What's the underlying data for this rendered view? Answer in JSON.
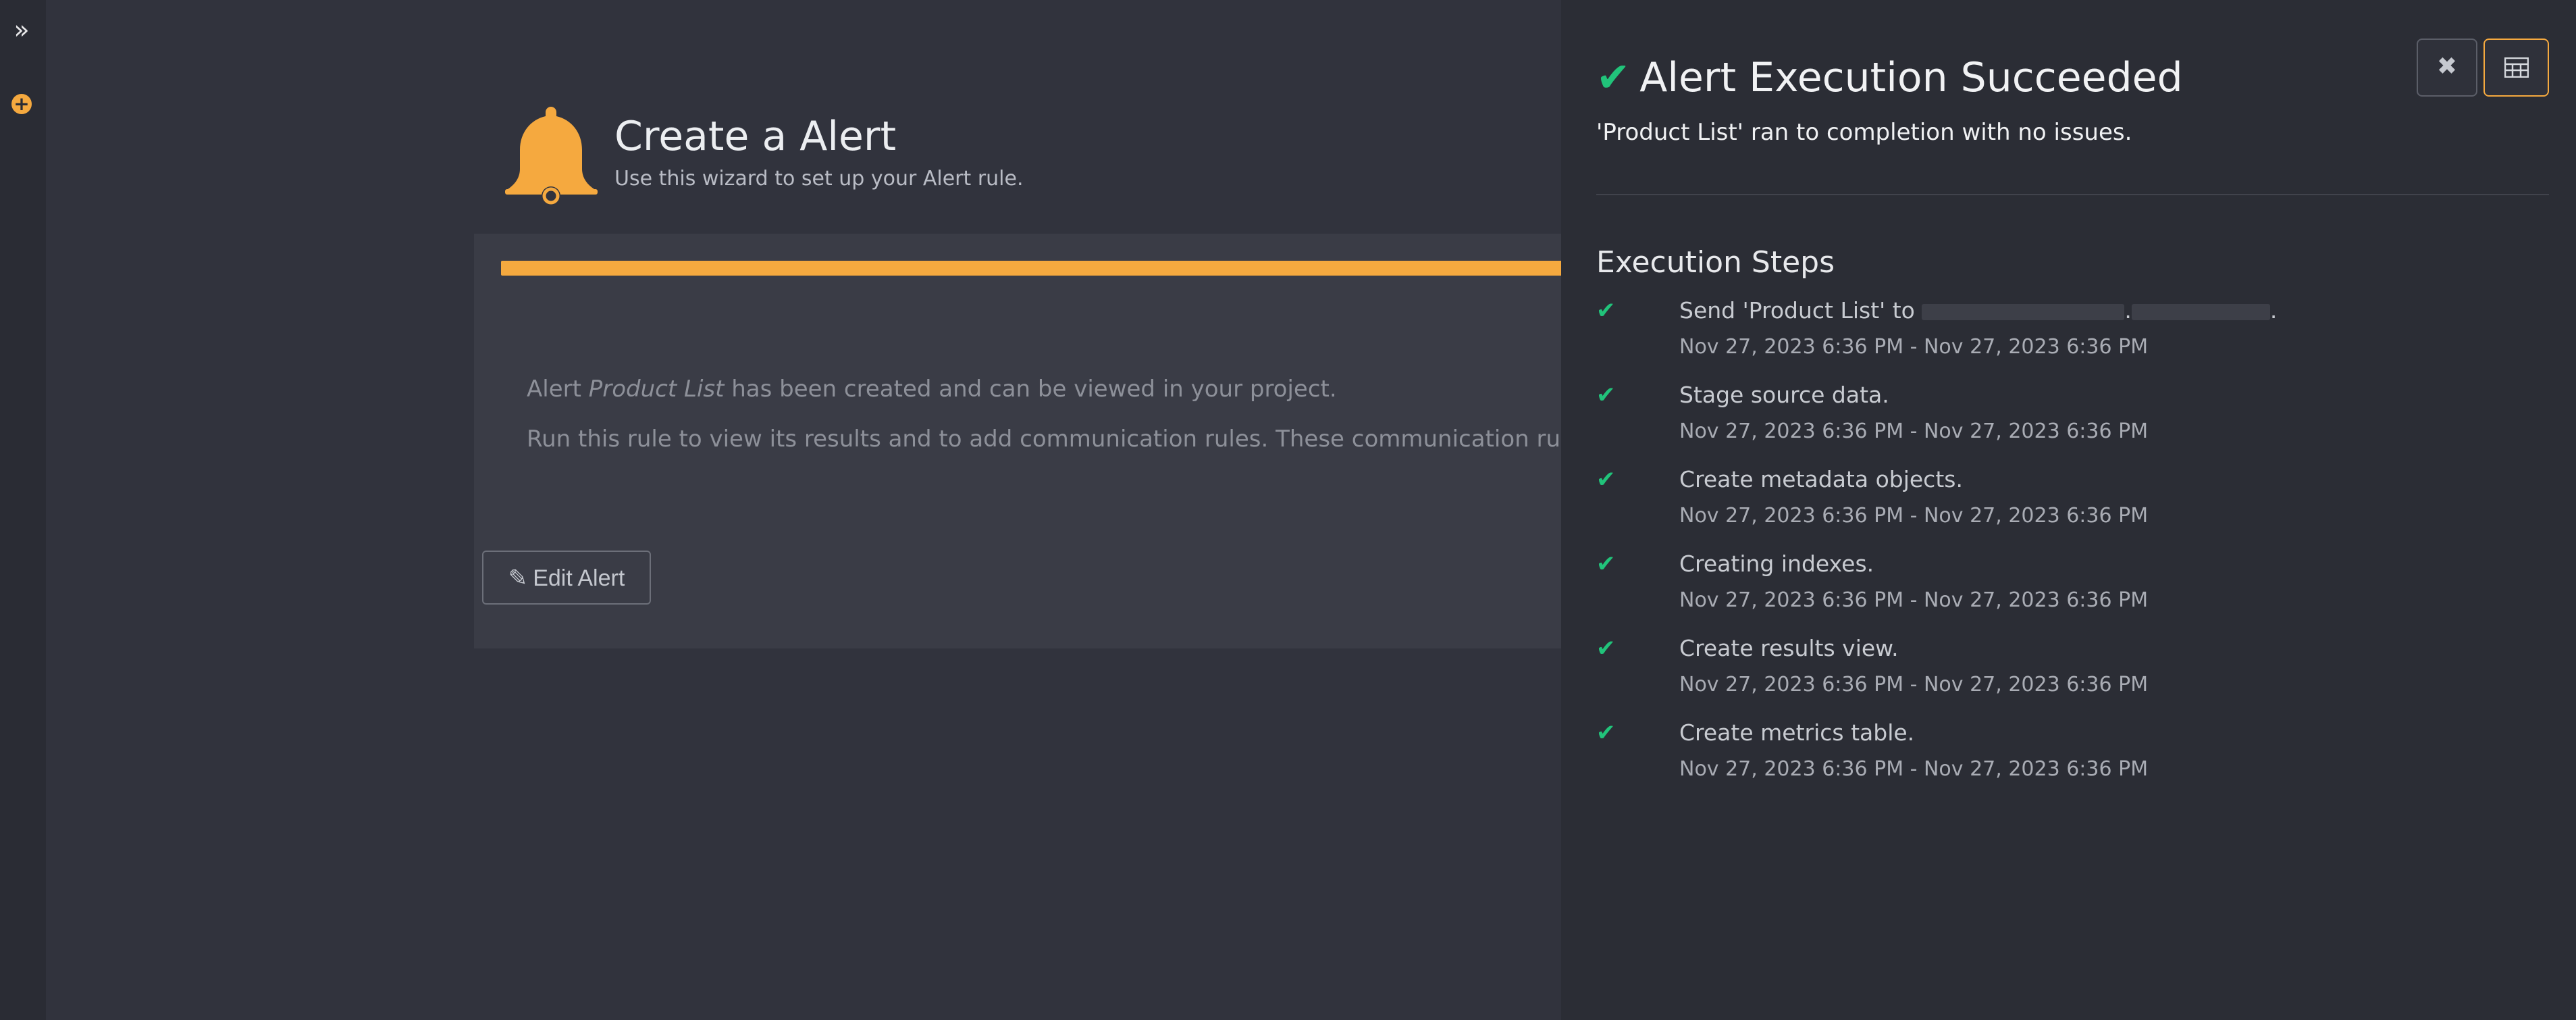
{
  "rail": {
    "toggle_icon": "double-chevron-right-icon",
    "add_icon": "plus-circle-icon"
  },
  "wizard": {
    "title": "Create a Alert",
    "subtitle": "Use this wizard to set up your Alert rule.",
    "message_prefix": "Alert",
    "message_name": "Product List",
    "message_suffix": "has been created and can be viewed in your project.",
    "message_line2": "Run this rule to view its results and to add communication rules. These communication rules will d",
    "edit_button_label": "Edit Alert",
    "progress_percent": 100
  },
  "panel": {
    "title": "Alert Execution Succeeded",
    "subtitle": "'Product List' ran to completion with no issues.",
    "steps_heading": "Execution Steps",
    "steps": [
      {
        "label": "Send 'Product List' to",
        "time": "Nov 27, 2023 6:36 PM - Nov 27, 2023 6:36 PM"
      },
      {
        "label": "Stage source data.",
        "time": "Nov 27, 2023 6:36 PM - Nov 27, 2023 6:36 PM"
      },
      {
        "label": "Create metadata objects.",
        "time": "Nov 27, 2023 6:36 PM - Nov 27, 2023 6:36 PM"
      },
      {
        "label": "Creating indexes.",
        "time": "Nov 27, 2023 6:36 PM - Nov 27, 2023 6:36 PM"
      },
      {
        "label": "Create results view.",
        "time": "Nov 27, 2023 6:36 PM - Nov 27, 2023 6:36 PM"
      },
      {
        "label": "Create metrics table.",
        "time": "Nov 27, 2023 6:36 PM - Nov 27, 2023 6:36 PM"
      }
    ]
  },
  "colors": {
    "accent": "#f5a93f",
    "success": "#21c37a",
    "background": "#31333d",
    "panel": "#2b2d35"
  }
}
